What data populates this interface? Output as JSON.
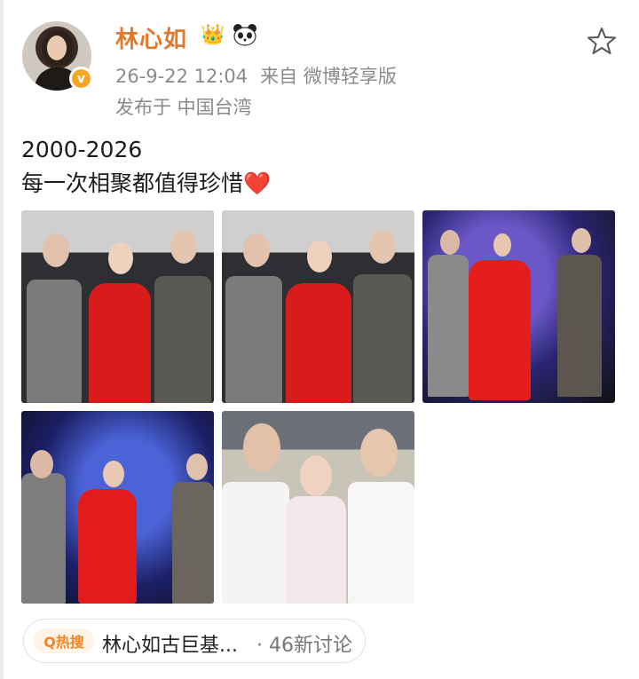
{
  "post": {
    "username": "林心如",
    "timestamp": "26-9-22 12:04",
    "source": "来自 微博轻享版",
    "location": "发布于 中国台湾",
    "line1": "2000-2026",
    "line2": "每一次相聚都值得珍惜",
    "heart": "❤️",
    "crown": "👑",
    "verified": "v"
  },
  "topic": {
    "badge": "Q热搜",
    "title": "林心如古巨基...",
    "count": "· 46新讨论"
  },
  "colors": {
    "username": "#e2782b",
    "accent": "#f5841f",
    "heart": "#e0282b"
  },
  "icons": [
    "crown-icon",
    "panda-icon",
    "star-icon",
    "verified-badge-icon",
    "search-icon"
  ]
}
